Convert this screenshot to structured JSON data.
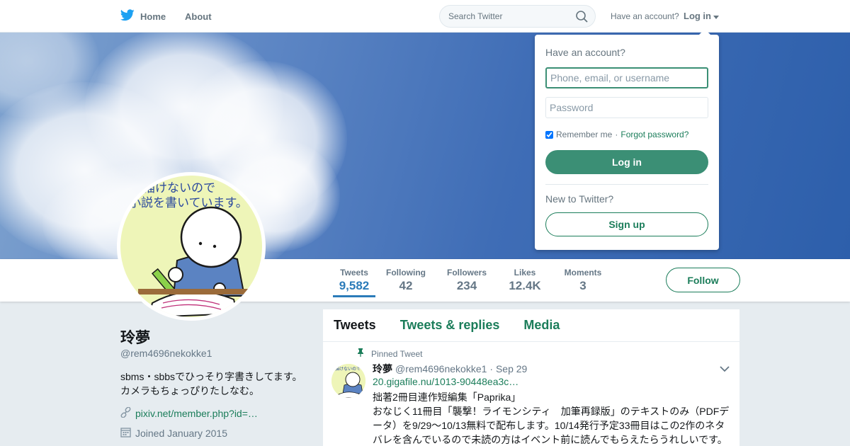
{
  "topnav": {
    "home_label": "Home",
    "about_label": "About",
    "search_placeholder": "Search Twitter",
    "have_account": "Have an account?",
    "login_label": "Log in"
  },
  "icons": {
    "brand": "twitter-bird-icon",
    "search": "search-icon",
    "caret": "caret-down-icon",
    "pin": "pin-icon",
    "link": "link-icon",
    "calendar": "calendar-icon"
  },
  "colors": {
    "accent": "#1b7d5a",
    "login_button": "#3b8f75",
    "active_stat": "#2b7bb9",
    "brand_bird": "#1da1f2",
    "page_bg": "#e6ecf0"
  },
  "avatar": {
    "text_line1": "描けないので",
    "text_line2": "小説を書いています。"
  },
  "profile_nav": {
    "stats": [
      {
        "label": "Tweets",
        "value": "9,582",
        "active": true
      },
      {
        "label": "Following",
        "value": "42"
      },
      {
        "label": "Followers",
        "value": "234"
      },
      {
        "label": "Likes",
        "value": "12.4K"
      },
      {
        "label": "Moments",
        "value": "3"
      }
    ],
    "follow_label": "Follow"
  },
  "profile": {
    "name": "玲夢",
    "handle": "@rem4696nekokke1",
    "bio_line1": "sbms・sbbsでひっそり字書きしてます。",
    "bio_line2": "カメラもちょっぴりたしなむ。",
    "link": "pixiv.net/member.php?id=…",
    "joined": "Joined January 2015"
  },
  "timeline": {
    "tabs": [
      "Tweets",
      "Tweets & replies",
      "Media"
    ],
    "active_tab": "Tweets",
    "pinned_label": "Pinned Tweet",
    "tweet": {
      "name": "玲夢",
      "handle": "@rem4696nekokke1",
      "date": "· Sep 29",
      "link": "20.gigafile.nu/1013-90448ea3c…",
      "text_line1": "拙著2冊目連作短編集「Paprika」",
      "text_line2": "おなじく11冊目「襲撃！ライモンシティ　加筆再録版」のテキストのみ（PDFデータ）を9/29～10/13無料で配布します。10/14発行予定33冊目はこの2作のネタバレを含んでいるので未読の方はイベント前に読んでもらえたらうれしいです。"
    }
  },
  "login_dropdown": {
    "title": "Have an account?",
    "username_placeholder": "Phone, email, or username",
    "password_placeholder": "Password",
    "remember_label": "Remember me",
    "separator": "·",
    "forgot_label": "Forgot password?",
    "remember_checked": true,
    "login_button": "Log in",
    "new_label": "New to Twitter?",
    "signup_button": "Sign up"
  }
}
